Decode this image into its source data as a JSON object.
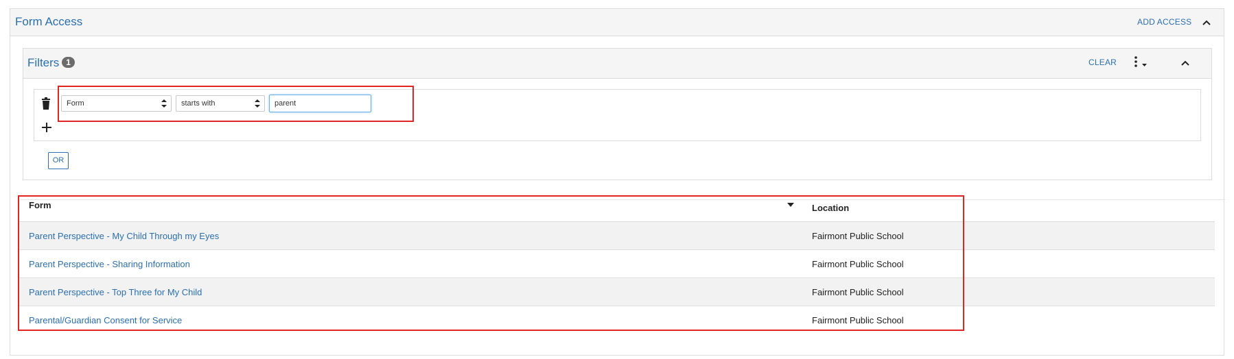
{
  "panel": {
    "title": "Form Access",
    "add_access_label": "ADD ACCESS"
  },
  "filters": {
    "title": "Filters",
    "count": "1",
    "clear_label": "CLEAR",
    "field_select": "Form",
    "operator_select": "starts with",
    "value": "parent",
    "or_label": "OR"
  },
  "table": {
    "headers": {
      "form": "Form",
      "location": "Location"
    },
    "rows": [
      {
        "form": "Parent Perspective - My Child Through my Eyes",
        "location": "Fairmont Public School"
      },
      {
        "form": "Parent Perspective - Sharing Information",
        "location": "Fairmont Public School"
      },
      {
        "form": "Parent Perspective - Top Three for My Child",
        "location": "Fairmont Public School"
      },
      {
        "form": "Parental/Guardian Consent for Service",
        "location": "Fairmont Public School"
      }
    ]
  },
  "colors": {
    "accent": "#2a6fb0",
    "highlight": "#e02424"
  }
}
